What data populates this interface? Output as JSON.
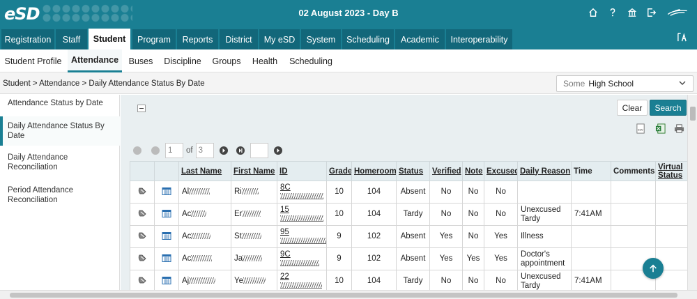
{
  "app": {
    "logo": "eSD",
    "date_banner": "02 August 2023 - Day B"
  },
  "main_tabs": [
    {
      "label": "Registration",
      "active": false
    },
    {
      "label": "Staff",
      "active": false
    },
    {
      "label": "Student",
      "active": true
    },
    {
      "label": "Program",
      "active": false
    },
    {
      "label": "Reports",
      "active": false
    },
    {
      "label": "District",
      "active": false
    },
    {
      "label": "My eSD",
      "active": false
    },
    {
      "label": "System",
      "active": false
    },
    {
      "label": "Scheduling",
      "active": false
    },
    {
      "label": "Academic",
      "active": false
    },
    {
      "label": "Interoperability",
      "active": false
    }
  ],
  "sub_tabs": [
    {
      "label": "Student Profile",
      "active": false
    },
    {
      "label": "Attendance",
      "active": true
    },
    {
      "label": "Buses",
      "active": false
    },
    {
      "label": "Discipline",
      "active": false
    },
    {
      "label": "Groups",
      "active": false
    },
    {
      "label": "Health",
      "active": false
    },
    {
      "label": "Scheduling",
      "active": false
    }
  ],
  "breadcrumb": "Student > Attendance > Daily Attendance Status By Date",
  "school_select": {
    "prefix": "Some",
    "value": "High School"
  },
  "sidebar": [
    {
      "label": "Attendance Status by Date",
      "active": false
    },
    {
      "label": "Daily Attendance Status By Date",
      "active": true
    },
    {
      "label": "Daily Attendance Reconciliation",
      "active": false
    },
    {
      "label": "Period Attendance Reconciliation",
      "active": false
    }
  ],
  "buttons": {
    "clear": "Clear",
    "search": "Search"
  },
  "export_icons": [
    "csv-icon",
    "excel-icon",
    "print-icon"
  ],
  "pager": {
    "page": "1",
    "of_label": "of",
    "total": "3",
    "goto": ""
  },
  "table": {
    "columns": [
      "",
      "",
      "Last Name",
      "First Name",
      "ID",
      "Grade",
      "Homeroom",
      "Status",
      "Verified",
      "Note",
      "Excused",
      "Daily Reason",
      "Time",
      "Comments",
      "Virtual Status"
    ],
    "rows": [
      {
        "last": "Al",
        "first": "Ri",
        "id": "8C",
        "grade": "10",
        "homeroom": "104",
        "status": "Absent",
        "verified": "No",
        "note": "No",
        "excused": "No",
        "reason": "",
        "time": ""
      },
      {
        "last": "Ac",
        "first": "Er",
        "id": "15",
        "grade": "10",
        "homeroom": "104",
        "status": "Tardy",
        "verified": "No",
        "note": "No",
        "excused": "No",
        "reason": "Unexcused Tardy",
        "time": "7:41AM"
      },
      {
        "last": "Ac",
        "first": "St",
        "id": "95",
        "grade": "9",
        "homeroom": "102",
        "status": "Absent",
        "verified": "Yes",
        "note": "No",
        "excused": "Yes",
        "reason": "Illness",
        "time": ""
      },
      {
        "last": "Ac",
        "first": "Ja",
        "id": "9C",
        "grade": "9",
        "homeroom": "102",
        "status": "Absent",
        "verified": "Yes",
        "note": "Yes",
        "excused": "Yes",
        "reason": "Doctor's appointment",
        "time": ""
      },
      {
        "last": "Aj",
        "first": "Ye",
        "id": "22",
        "grade": "10",
        "homeroom": "104",
        "status": "Tardy",
        "verified": "No",
        "note": "No",
        "excused": "No",
        "reason": "Unexcused Tardy",
        "time": "7:41AM"
      }
    ]
  },
  "colors": {
    "accent": "#1a7f93",
    "tab_dark": "#12677a",
    "header_bg": "#e4edf0"
  }
}
